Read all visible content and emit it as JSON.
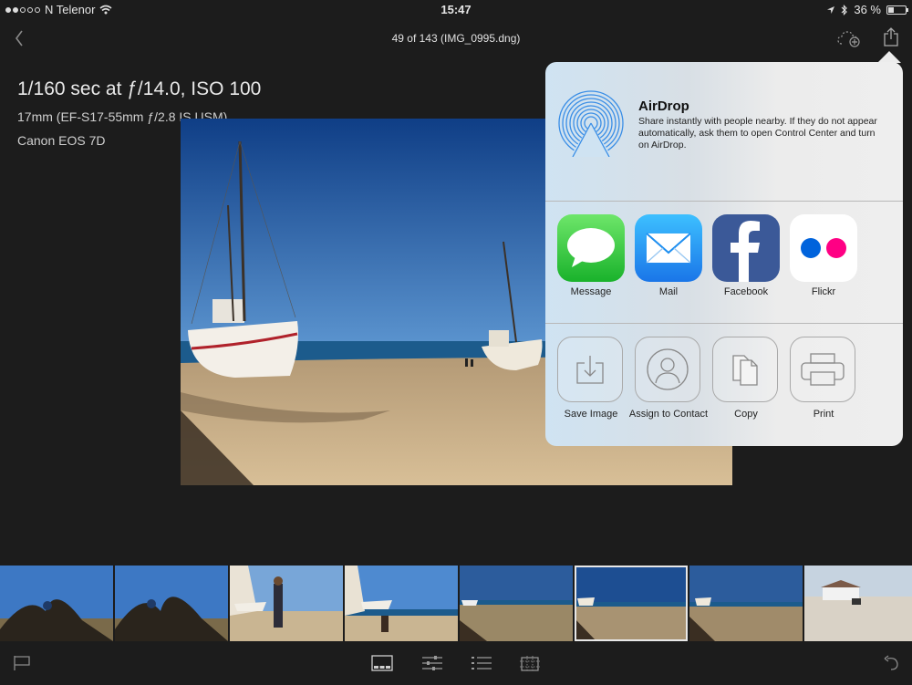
{
  "status": {
    "carrier": "N Telenor",
    "time": "15:47",
    "battery": "36 %",
    "battery_level": 0.36,
    "signal_dots_filled": 2,
    "signal_dots_total": 5
  },
  "nav": {
    "title": "49 of 143 (IMG_0995.dng)",
    "back_icon": "chevron-left-icon",
    "cloud_icon": "cloud-add-icon",
    "share_icon": "share-icon"
  },
  "exif": {
    "exposure": "1/160 sec at ƒ/14.0, ISO 100",
    "lens": "17mm (EF-S17-55mm ƒ/2.8 IS USM)",
    "camera": "Canon EOS 7D"
  },
  "share_sheet": {
    "airdrop": {
      "title": "AirDrop",
      "description": "Share instantly with people nearby. If they do not appear automatically, ask them to open Control Center and turn on AirDrop."
    },
    "apps": [
      {
        "label": "Message",
        "icon": "message-icon"
      },
      {
        "label": "Mail",
        "icon": "mail-icon"
      },
      {
        "label": "Facebook",
        "icon": "facebook-icon"
      },
      {
        "label": "Flickr",
        "icon": "flickr-icon"
      }
    ],
    "actions": [
      {
        "label": "Save Image",
        "icon": "save-image-icon"
      },
      {
        "label": "Assign to Contact",
        "icon": "contact-icon"
      },
      {
        "label": "Copy",
        "icon": "copy-icon"
      },
      {
        "label": "Print",
        "icon": "print-icon"
      }
    ]
  },
  "filmstrip": {
    "count": 8,
    "selected_index": 5
  },
  "toolbar": {
    "icons": [
      "flag-icon",
      "filmstrip-view-icon",
      "adjust-sliders-icon",
      "list-icon",
      "crop-icon",
      "undo-icon"
    ]
  },
  "colors": {
    "background": "#1c1c1c",
    "sky": "#1f5ea8",
    "sand": "#c9ae86",
    "facebook": "#3b5998",
    "message": "#34c94a",
    "mail": "#1d8ef0",
    "flickr_blue": "#0063dc",
    "flickr_pink": "#ff0084"
  }
}
